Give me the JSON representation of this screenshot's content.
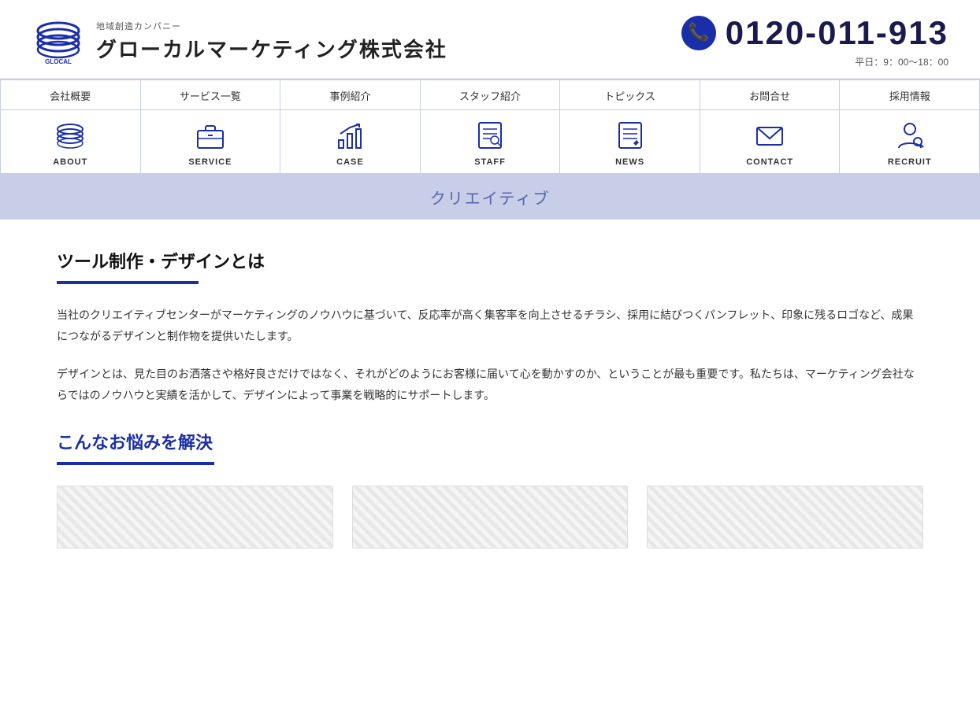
{
  "header": {
    "logo_subtitle": "地域創造カンパニー",
    "logo_title": "グローカルマーケティング株式会社",
    "logo_alt": "GLOCAL",
    "phone_number": "0120-011-913",
    "phone_hours": "平日：9：00～18：00"
  },
  "nav_top": {
    "items": [
      {
        "label": "会社概要",
        "id": "about"
      },
      {
        "label": "サービス一覧",
        "id": "service"
      },
      {
        "label": "事例紹介",
        "id": "case"
      },
      {
        "label": "スタッフ紹介",
        "id": "staff"
      },
      {
        "label": "トピックス",
        "id": "news"
      },
      {
        "label": "お問合せ",
        "id": "contact"
      },
      {
        "label": "採用情報",
        "id": "recruit"
      }
    ]
  },
  "nav_icons": {
    "items": [
      {
        "label": "ABOUT",
        "id": "about"
      },
      {
        "label": "SERVICE",
        "id": "service"
      },
      {
        "label": "CASE",
        "id": "case"
      },
      {
        "label": "STAFF",
        "id": "staff"
      },
      {
        "label": "NEWS",
        "id": "news"
      },
      {
        "label": "CONTACT",
        "id": "contact"
      },
      {
        "label": "RECRUIT",
        "id": "recruit"
      }
    ]
  },
  "category_banner": {
    "text": "クリエイティブ"
  },
  "main": {
    "section1_title": "ツール制作・デザインとは",
    "body1": "当社のクリエイティブセンターがマーケティングのノウハウに基づいて、反応率が高く集客率を向上させるチラシ、採用に結びつくパンフレット、印象に残るロゴなど、成果につながるデザインと制作物を提供いたします。",
    "body2": "デザインとは、見た目のお洒落さや格好良さだけではなく、それがどのようにお客様に届いて心を動かすのか、ということが最も重要です。私たちは、マーケティング会社ならではのノウハウと実績を活かして、デザインによって事業を戦略的にサポートします。",
    "section2_title": "こんなお悩みを解決"
  }
}
